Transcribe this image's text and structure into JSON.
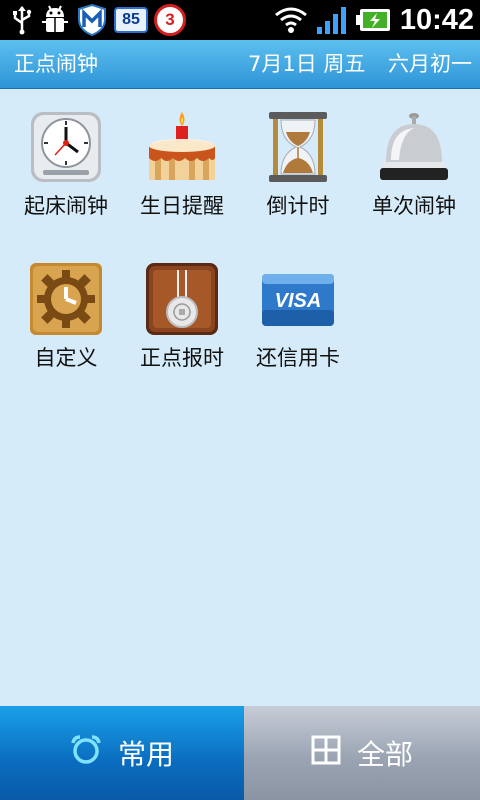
{
  "status_bar": {
    "notif_count_1": "85",
    "notif_count_2": "3",
    "time": "10:42"
  },
  "header": {
    "title": "正点闹钟",
    "date": "7月1日 周五",
    "lunar": "六月初一"
  },
  "apps": [
    {
      "label": "起床闹钟",
      "icon": "alarm-clock-icon"
    },
    {
      "label": "生日提醒",
      "icon": "birthday-cake-icon"
    },
    {
      "label": "倒计时",
      "icon": "hourglass-icon"
    },
    {
      "label": "单次闹钟",
      "icon": "service-bell-icon"
    },
    {
      "label": "自定义",
      "icon": "gear-clock-icon"
    },
    {
      "label": "正点报时",
      "icon": "pendulum-clock-icon"
    },
    {
      "label": "还信用卡",
      "icon": "visa-card-icon"
    }
  ],
  "tabs": {
    "common": "常用",
    "all": "全部"
  },
  "colors": {
    "accent": "#2d94d6",
    "background": "#d6ebf9",
    "tab_active": "#0a6cbf",
    "tab_inactive": "#9aa4b3"
  }
}
